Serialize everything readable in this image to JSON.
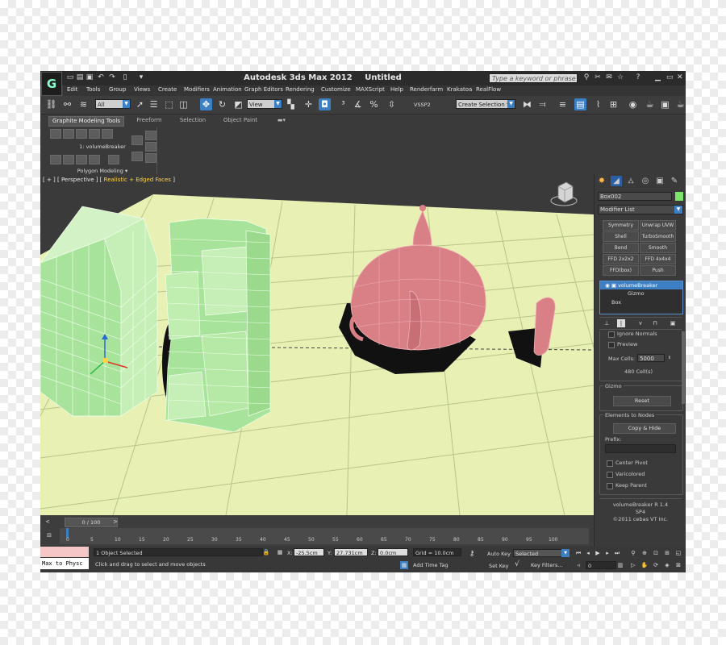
{
  "window": {
    "app_name": "Autodesk 3ds Max  2012",
    "doc_name": "Untitled",
    "search_placeholder": "Type a keyword or phrase",
    "logo_text": "G"
  },
  "menu": [
    "Edit",
    "Tools",
    "Group",
    "Views",
    "Create",
    "Modifiers",
    "Animation",
    "Graph Editors",
    "Rendering",
    "Customize",
    "MAXScript",
    "Help",
    "Renderfarm",
    "Krakatoa",
    "RealFlow"
  ],
  "toolbar": {
    "selection_filter": "All",
    "ref_coord": "View",
    "vssp": "VSSP2",
    "named_selection": "Create Selection Se"
  },
  "ribbon": {
    "tabs": [
      "Graphite Modeling Tools",
      "Freeform",
      "Selection",
      "Object Paint"
    ],
    "item": "1: volumeBreaker",
    "group_label": "Polygon Modeling"
  },
  "viewport": {
    "label_prefix": "[ + ] [ Perspective ] [",
    "label_shading": "Realistic + Edged Faces",
    "label_suffix": "]",
    "colors": {
      "ground": "#e8f0b4",
      "grid": "#b9c489",
      "box": "#a7e39a",
      "teapot": "#d97f86",
      "shadow": "#111111"
    }
  },
  "command_panel": {
    "object_name": "Box002",
    "modifier_list": "Modifier List",
    "mod_buttons": [
      "Symmetry",
      "Unwrap UVW",
      "Shell",
      "TurboSmooth",
      "Bend",
      "Smooth",
      "FFD 2x2x2",
      "FFD 4x4x4",
      "FFD(box)",
      "Push"
    ],
    "stack": [
      "volumeBreaker",
      "Gizmo",
      "Box"
    ],
    "ignore_normals": "Ignore Normals",
    "preview": "Preview",
    "max_cells_label": "Max Cells:",
    "max_cells_value": "5000",
    "cells_count": "480 Cell(s)",
    "gizmo_title": "Gizmo",
    "reset": "Reset",
    "elements_title": "Elements to Nodes",
    "copy_hide": "Copy & Hide",
    "prefix_label": "Prefix:",
    "center_pivot": "Center Pivot",
    "varicolored": "Varicolored",
    "keep_parent": "Keep Parent",
    "version": "volumeBreaker R 1.4",
    "sp": "SP4",
    "copyright": "©2011 cebas VT Inc."
  },
  "timeline": {
    "slider": "0 / 100",
    "ticks": [
      "0",
      "5",
      "10",
      "15",
      "20",
      "25",
      "30",
      "35",
      "40",
      "45",
      "50",
      "55",
      "60",
      "65",
      "70",
      "75",
      "80",
      "85",
      "90",
      "95",
      "100"
    ]
  },
  "status": {
    "maxscript": "Max to Physc",
    "selected": "1 Object Selected",
    "prompt": "Click and drag to select and move objects",
    "x": "-25.5cm",
    "y": "27.731cm",
    "z": "0.0cm",
    "grid": "Grid = 10.0cm",
    "add_time_tag": "Add Time Tag",
    "auto_key": "Auto Key",
    "set_key": "Set Key",
    "key_mode": "Selected",
    "key_filters": "Key Filters...",
    "frame": "0"
  }
}
